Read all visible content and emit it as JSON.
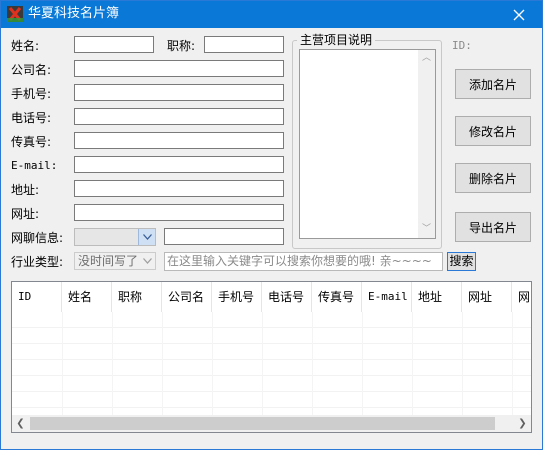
{
  "window": {
    "title": "华夏科技名片簿",
    "icon": "app-logo-icon",
    "close": "close-icon"
  },
  "form": {
    "name_label": "姓名:",
    "job_label": "职称:",
    "company_label": "公司名:",
    "mobile_label": "手机号:",
    "phone_label": "电话号:",
    "fax_label": "传真号:",
    "email_label": "E-mail:",
    "address_label": "地址:",
    "website_label": "网址:",
    "im_label": "网聊信息:",
    "industry_label": "行业类型:",
    "industry_value": "没时间写了",
    "id_label": "ID:"
  },
  "project": {
    "group_title": "主营项目说明"
  },
  "buttons": {
    "add": "添加名片",
    "edit": "修改名片",
    "delete": "删除名片",
    "export": "导出名片",
    "search": "搜索"
  },
  "search": {
    "placeholder": "在这里输入关键字可以搜索你想要的哦! 亲~~~~"
  },
  "table": {
    "columns": [
      "ID",
      "姓名",
      "职称",
      "公司名",
      "手机号",
      "电话号",
      "传真号",
      "E-mail",
      "地址",
      "网址",
      "网"
    ]
  },
  "colors": {
    "titlebar": "#0a78d7",
    "window_bg": "#f0f0f0"
  }
}
